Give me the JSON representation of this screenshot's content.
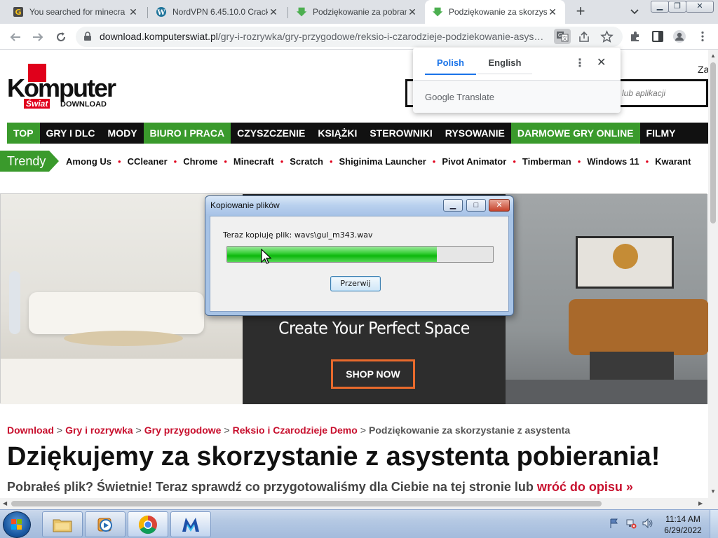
{
  "browser": {
    "tabs": [
      {
        "title": "You searched for minecra",
        "favicon": "g-favicon"
      },
      {
        "title": "NordVPN 6.45.10.0 Crack",
        "favicon": "wordpress-favicon"
      },
      {
        "title": "Podziękowanie za pobran",
        "favicon": "download-arrow-favicon"
      },
      {
        "title": "Podziękowanie za skorzys",
        "favicon": "download-arrow-favicon",
        "active": true
      }
    ],
    "url_domain": "download.komputerswiat.pl",
    "url_path": "/gry-i-rozrywka/gry-przygodowe/reksio-i-czarodzieje-podziekowanie-asys…"
  },
  "translate_popup": {
    "tab_source": "Polish",
    "tab_target": "English",
    "brand": "Google Translate"
  },
  "site": {
    "logo_main": "Komputer",
    "logo_swiat": "Świat",
    "logo_download": "DOWNLOAD",
    "search_placeholder": "lub aplikacji",
    "header_right": "Za",
    "nav": [
      {
        "label": "TOP",
        "green": true
      },
      {
        "label": "GRY I DLC",
        "green": false
      },
      {
        "label": "MODY",
        "green": false
      },
      {
        "label": "BIURO I PRACA",
        "green": true
      },
      {
        "label": "CZYSZCZENIE",
        "green": false
      },
      {
        "label": "KSIĄŻKI",
        "green": false
      },
      {
        "label": "STEROWNIKI",
        "green": false
      },
      {
        "label": "RYSOWANIE",
        "green": false
      },
      {
        "label": "DARMOWE GRY ONLINE",
        "green": true
      },
      {
        "label": "FILMY",
        "green": false
      }
    ],
    "trendy_label": "Trendy",
    "trendy": [
      "Among Us",
      "CCleaner",
      "Chrome",
      "Minecraft",
      "Scratch",
      "Shiginima Launcher",
      "Pivot Animator",
      "Timberman",
      "Windows 11",
      "Kwarant"
    ],
    "banner": {
      "title": "Create Your Perfect Space",
      "button": "SHOP NOW"
    },
    "breadcrumb": [
      "Download",
      "Gry i rozrywka",
      "Gry przygodowe",
      "Reksio i Czarodzieje Demo"
    ],
    "breadcrumb_sep": ">",
    "breadcrumb_current": "Podziękowanie za skorzystanie z asystenta",
    "heading": "Dziękujemy za skorzystanie z asystenta pobierania!",
    "subline": "Pobrałeś plik? Świetnie! Teraz sprawdź co przygotowaliśmy dla Ciebie na tej stronie lub",
    "subline_link": "wróć do opisu »"
  },
  "dialog": {
    "title": "Kopiowanie plików",
    "message": "Teraz kopiuję plik: wavs\\gul_m343.wav",
    "progress_fraction": 0.79,
    "button": "Przerwij"
  },
  "taskbar": {
    "time": "11:14 AM",
    "date": "6/29/2022",
    "apps": [
      "file-explorer-icon",
      "media-player-icon",
      "chrome-icon",
      "installer-m-icon"
    ]
  }
}
